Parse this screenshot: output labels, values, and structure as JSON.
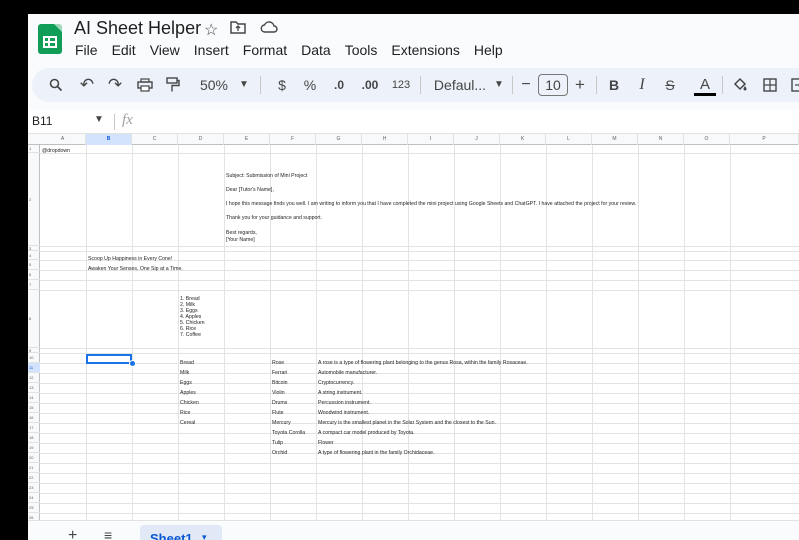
{
  "app": {
    "title": "AI Sheet Helper",
    "menu": [
      "File",
      "Edit",
      "View",
      "Insert",
      "Format",
      "Data",
      "Tools",
      "Extensions",
      "Help"
    ]
  },
  "toolbar": {
    "zoom": "50%",
    "currency": "$",
    "percent": "%",
    "dec_decrease": ".0",
    "dec_increase": ".00",
    "number_format": "123",
    "font": "Defaul...",
    "font_size": "10",
    "minus": "−",
    "plus": "+",
    "bold": "B",
    "italic": "I",
    "strike": "S",
    "text_color": "A"
  },
  "formula_bar": {
    "name_box": "B11",
    "fx": "fx"
  },
  "columns": [
    "A",
    "B",
    "C",
    "D",
    "E",
    "F",
    "G",
    "H",
    "I",
    "J",
    "K",
    "L",
    "M",
    "N",
    "O",
    "P"
  ],
  "rows": [
    "1",
    "2",
    "3",
    "4",
    "5",
    "6",
    "7",
    "8",
    "9",
    "10",
    "11",
    "12",
    "13",
    "14",
    "15",
    "16",
    "17",
    "18",
    "19",
    "20",
    "21",
    "22",
    "23",
    "24",
    "25",
    "26",
    "27",
    "28",
    "29",
    "30"
  ],
  "cells": {
    "a1": "@dropdown",
    "email": [
      "Subject: Submission of Mini Project",
      "Dear [Tutor's Name],",
      "I hope this message finds you well. I am writing to inform you that I have completed the mini project using Google Sheets and ChatGPT. I have attached the project for your review.",
      "Thank you for your guidance and support.",
      "Best regards,",
      "[Your Name]"
    ],
    "slogans": [
      "Scoop Up Happiness in Every Cone!",
      "Awaken Your Senses, One Sip at a Time."
    ],
    "list": [
      "1. Bread",
      "2. Milk",
      "3. Eggs",
      "4. Apples",
      "5. Chicken",
      "6. Rice",
      "7. Coffee"
    ],
    "col_d": [
      "Bread",
      "Milk",
      "Eggs",
      "Apples",
      "Chicken",
      "Rice",
      "Cereal"
    ],
    "col_f": [
      "Rose",
      "Ferrari",
      "Bitcoin",
      "Violin",
      "Drums",
      "Flute",
      "Mercury",
      "Toyota Corolla",
      "Tulip",
      "Orchid"
    ],
    "col_g": [
      "A rose is a type of flowering plant belonging to the genus Rosa, within the family Rosaceae.",
      "Automobile manufacturer.",
      "Cryptocurrency.",
      "A string instrument.",
      "Percussion instrument.",
      "Woodwind instrument.",
      "Mercury is the smallest planet in the Solar System and the closest to the Sun.",
      "A compact car model produced by Toyota.",
      "Flower",
      "A type of flowering plant in the family Orchidaceae."
    ]
  },
  "sheets": {
    "add": "+",
    "all": "≡",
    "active": "Sheet1",
    "caret": "▾"
  },
  "colors": {
    "accent": "#0b57d0",
    "selection": "#1a73e8",
    "logo": "#0f9d58"
  }
}
